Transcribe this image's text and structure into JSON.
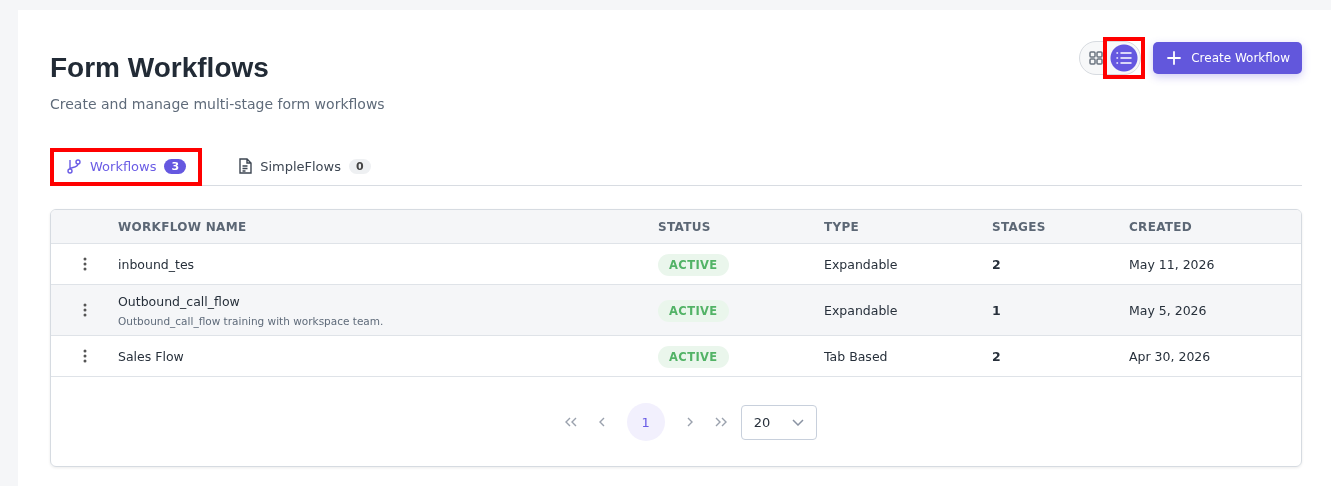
{
  "header": {
    "title": "Form Workflows",
    "subtitle": "Create and manage multi-stage form workflows"
  },
  "view_toggle": [
    {
      "kind": "grid",
      "selected": false,
      "highlighted": false
    },
    {
      "kind": "list",
      "selected": true,
      "highlighted": true
    }
  ],
  "create_button": {
    "label": "Create Workflow"
  },
  "tabs": [
    {
      "kind": "branch",
      "label": "Workflows",
      "count": "3",
      "selected": true,
      "highlighted": true
    },
    {
      "kind": "document",
      "label": "SimpleFlows",
      "count": "0",
      "selected": false,
      "highlighted": false
    }
  ],
  "table": {
    "columns": [
      "WORKFLOW NAME",
      "STATUS",
      "TYPE",
      "STAGES",
      "CREATED"
    ],
    "rows": [
      {
        "name": "inbound_tes",
        "status": "ACTIVE",
        "type": "Expandable",
        "stages": "2",
        "created": "May 11, 2026"
      },
      {
        "name": "Outbound_call_flow",
        "description": "Outbound_call_flow training with workspace team.",
        "status": "ACTIVE",
        "type": "Expandable",
        "stages": "1",
        "created": "May 5, 2026"
      },
      {
        "name": "Sales Flow",
        "status": "ACTIVE",
        "type": "Tab Based",
        "stages": "2",
        "created": "Apr 30, 2026"
      }
    ]
  },
  "pagination": {
    "pages": [
      {
        "label": "1",
        "selected": true
      }
    ],
    "page_size": "20"
  }
}
